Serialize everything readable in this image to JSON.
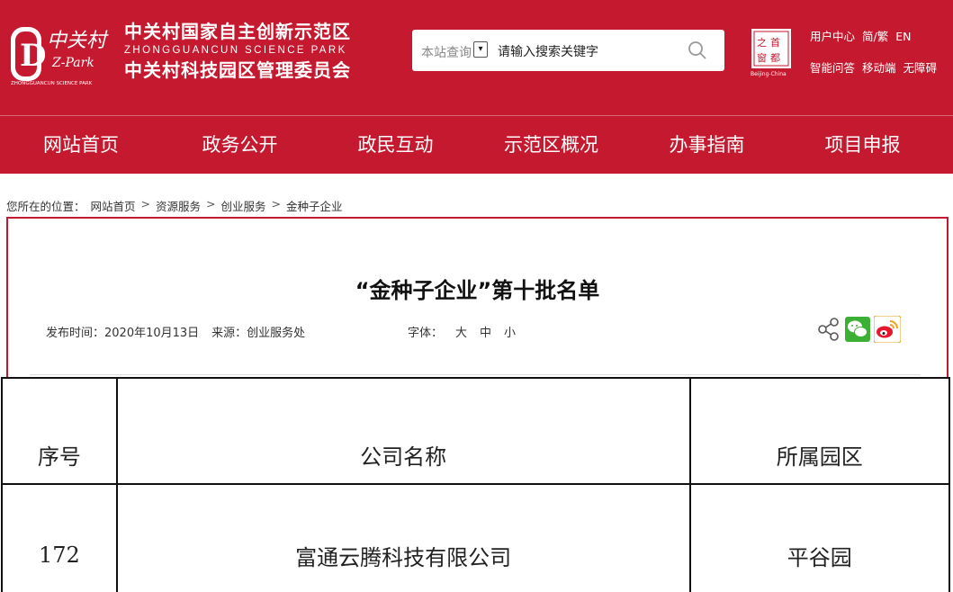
{
  "header": {
    "logo_text": "中关村 Z-Park",
    "brand_line1": "中关村国家自主创新示范区",
    "brand_line2": "ZHONGGUANCUN SCIENCE PARK",
    "brand_line3": "中关村科技园区管理委员会",
    "search": {
      "scope": "本站查询",
      "placeholder": "请输入搜索关键字"
    },
    "capital_badge": "首都之窗 Beijing-China",
    "links_row1": [
      "用户中心",
      "简/繁",
      "EN"
    ],
    "links_row2": [
      "智能问答",
      "移动端",
      "无障碍"
    ]
  },
  "nav": [
    "网站首页",
    "政务公开",
    "政民互动",
    "示范区概况",
    "办事指南",
    "项目申报"
  ],
  "breadcrumb": {
    "prefix": "您所在的位置：",
    "items": [
      "网站首页",
      "资源服务",
      "创业服务",
      "金种子企业"
    ]
  },
  "article": {
    "title": "“金种子企业”第十批名单",
    "publish": "发布时间：2020年10月13日",
    "source": "来源：创业服务处",
    "font_label": "字体：",
    "font_sizes": [
      "大",
      "中",
      "小"
    ]
  },
  "table": {
    "headers": [
      "序号",
      "公司名称",
      "所属园区"
    ],
    "rows": [
      [
        "172",
        "富通云腾科技有限公司",
        "平谷园"
      ]
    ]
  },
  "colors": {
    "brand_red": "#c4192f"
  },
  "icons": [
    "search-icon",
    "share-icon",
    "wechat-icon",
    "weibo-icon"
  ]
}
